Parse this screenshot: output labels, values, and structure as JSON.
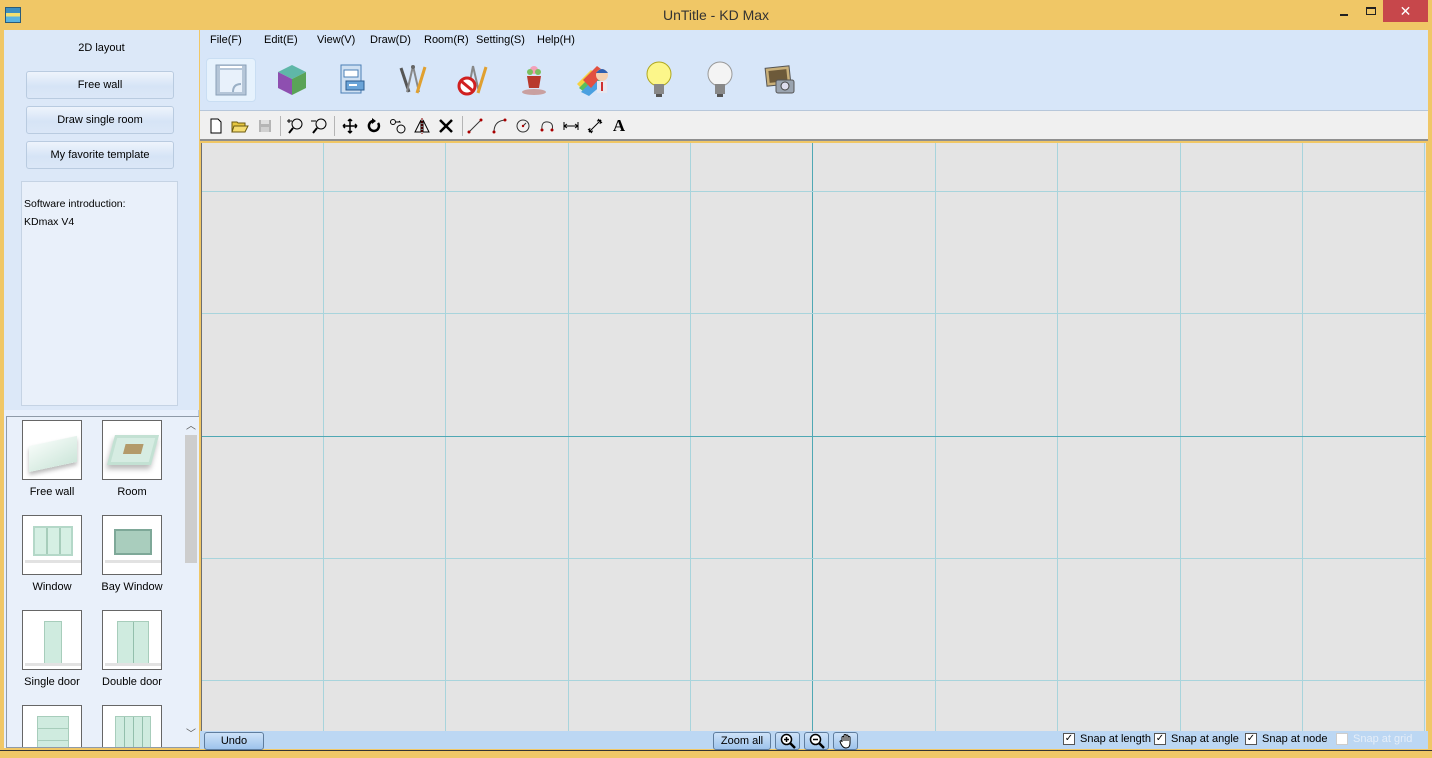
{
  "window": {
    "title": "UnTitle - KD Max",
    "icon": "kdmax-app-icon",
    "controls": {
      "minimize": "minimize-icon",
      "maximize": "maximize-icon",
      "close": "close-icon"
    }
  },
  "left_panel": {
    "heading": "2D layout",
    "buttons": [
      {
        "label": "Free wall"
      },
      {
        "label": "Draw single room"
      },
      {
        "label": "My favorite template"
      }
    ],
    "intro": {
      "line1": "Software introduction:",
      "line2": "KDmax V4"
    },
    "library": {
      "items": [
        {
          "label": "Free wall",
          "icon": "free-wall-thumbnail"
        },
        {
          "label": "Room",
          "icon": "room-thumbnail"
        },
        {
          "label": "Window",
          "icon": "window-thumbnail"
        },
        {
          "label": "Bay Window",
          "icon": "bay-window-thumbnail"
        },
        {
          "label": "Single door",
          "icon": "single-door-thumbnail"
        },
        {
          "label": "Double door",
          "icon": "double-door-thumbnail"
        },
        {
          "label": "",
          "icon": "grid-door-thumbnail"
        },
        {
          "label": "",
          "icon": "folding-door-thumbnail"
        }
      ]
    }
  },
  "menu": [
    {
      "label": "File(F)"
    },
    {
      "label": "Edit(E)"
    },
    {
      "label": "View(V)"
    },
    {
      "label": "Draw(D)"
    },
    {
      "label": "Room(R)"
    },
    {
      "label": "Setting(S)"
    },
    {
      "label": "Help(H)"
    }
  ],
  "big_toolbar": [
    {
      "icon": "2d-layout-icon",
      "active": true
    },
    {
      "icon": "3d-cube-icon"
    },
    {
      "icon": "cabinet-catalog-icon"
    },
    {
      "icon": "drawing-tools-icon"
    },
    {
      "icon": "clear-drawing-icon"
    },
    {
      "icon": "decoration-plant-icon"
    },
    {
      "icon": "material-designer-icon"
    },
    {
      "icon": "light-on-icon"
    },
    {
      "icon": "light-off-icon"
    },
    {
      "icon": "render-camera-icon"
    }
  ],
  "small_toolbar": [
    "new-file-icon",
    "open-folder-icon",
    "save-icon",
    "zoom-window-icon",
    "zoom-previous-icon",
    "move-icon",
    "rotate-icon",
    "copy-icon",
    "mirror-icon",
    "delete-icon",
    "line-icon",
    "arc-icon",
    "circle-icon",
    "curve-icon",
    "dimension-icon",
    "align-dimension-icon",
    "text-icon"
  ],
  "status_bar": {
    "undo": "Undo",
    "zoom_all": "Zoom all",
    "snaps": [
      {
        "label": "Snap at length",
        "checked": true,
        "enabled": true
      },
      {
        "label": "Snap at angle",
        "checked": true,
        "enabled": true
      },
      {
        "label": "Snap at node",
        "checked": true,
        "enabled": true
      },
      {
        "label": "Snap at grid",
        "checked": false,
        "enabled": false
      }
    ]
  },
  "colors": {
    "title_bar": "#f0c766",
    "panel_blue": "#d7e6f9",
    "canvas": "#e4e4e4",
    "grid_line": "#a8d4dc",
    "axis_line": "#4fa8b4",
    "close_button": "#c7474b"
  }
}
